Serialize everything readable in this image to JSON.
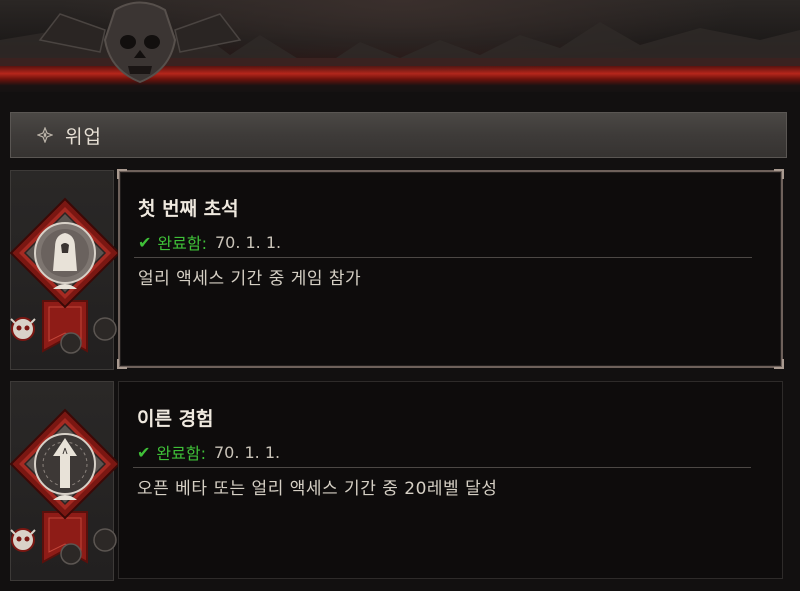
{
  "section": {
    "title": "위업",
    "icon": "diamond-bullet-icon"
  },
  "achievements": [
    {
      "title": "첫 번째 초석",
      "status_label": "완료함:",
      "status_date": "70. 1. 1.",
      "description": "얼리 액세스 기간 중 게임 참가",
      "emblem": "hooded-figure-icon",
      "selected": true
    },
    {
      "title": "이른 경험",
      "status_label": "완료함:",
      "status_date": "70. 1. 1.",
      "description": "오픈 베타 또는 얼리 액세스 기간 중 20레벨 달성",
      "emblem": "arrow-up-icon",
      "selected": false
    }
  ],
  "colors": {
    "completed": "#3fbf38",
    "banner_red": "#b6261b"
  }
}
